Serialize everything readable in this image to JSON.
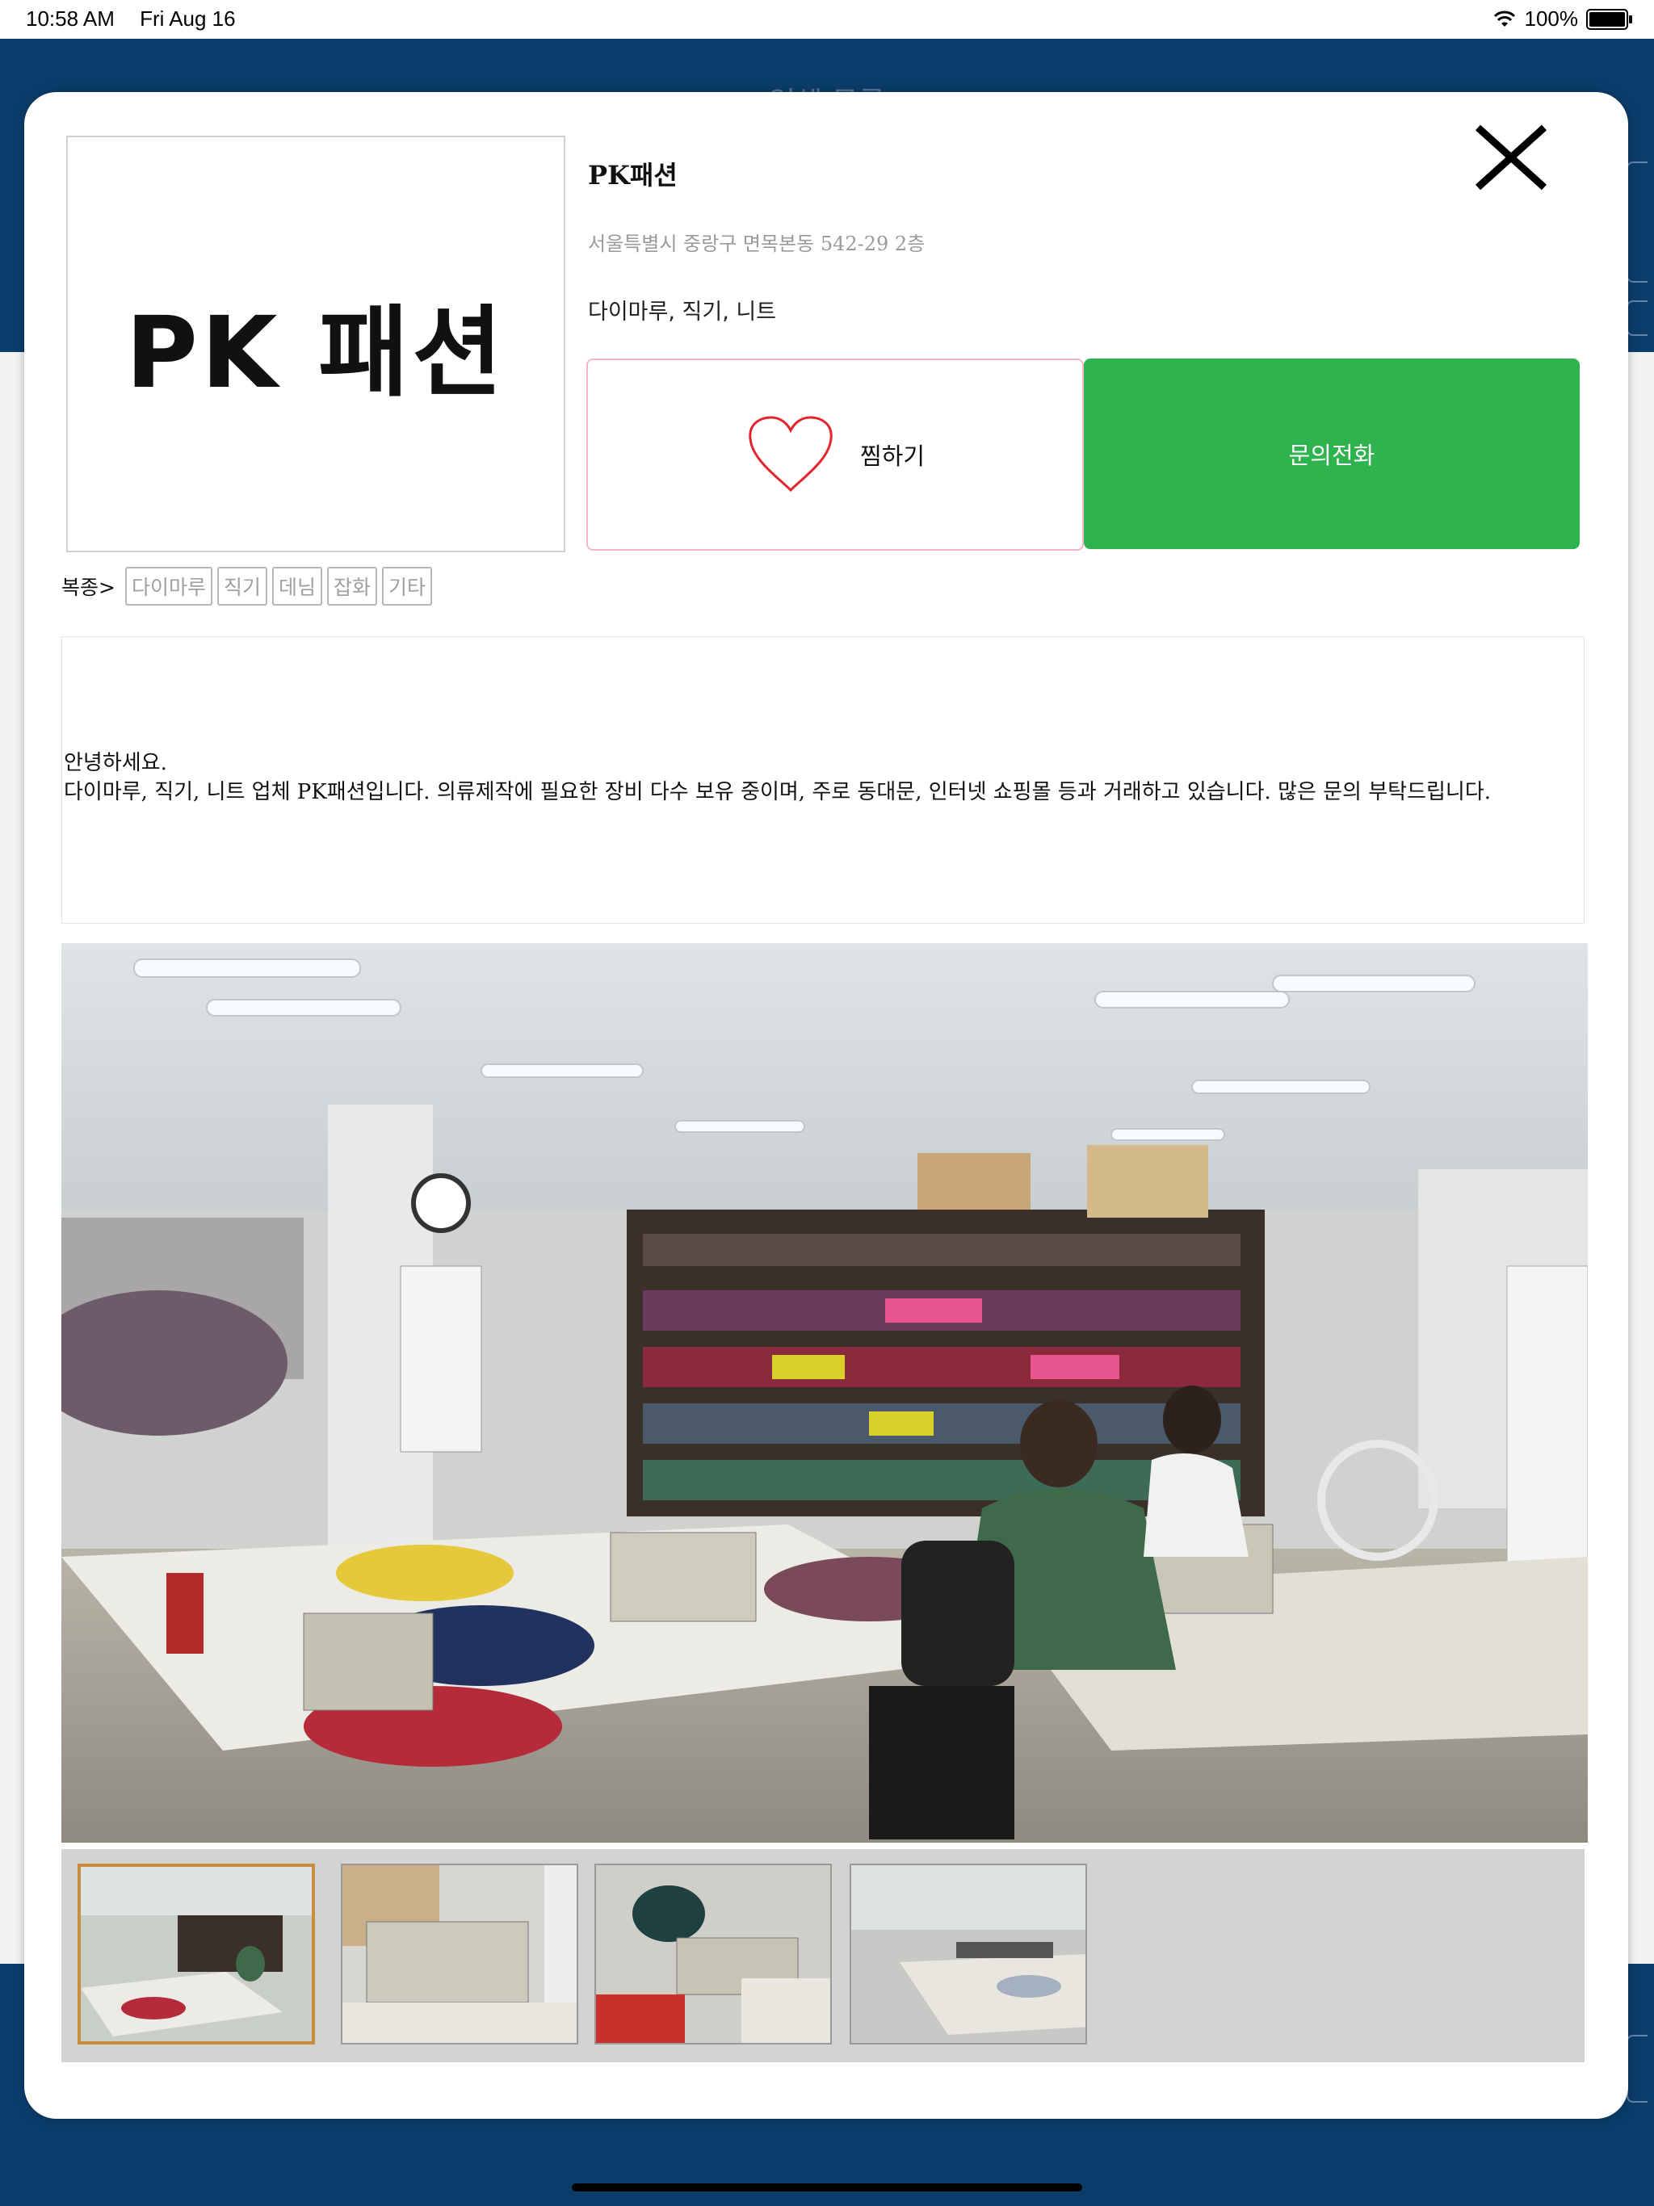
{
  "status_bar": {
    "time": "10:58 AM",
    "date": "Fri Aug 16",
    "battery": "100%",
    "battery_level": 1.0
  },
  "background": {
    "header_title": "업체 목록"
  },
  "shop": {
    "logo_text": "PK 패션",
    "name": "PK패션",
    "address": "서울특별시 중랑구 면목본동 542-29 2층",
    "categories": "다이마루, 직기, 니트",
    "wish_label": "찜하기",
    "call_label": "문의전화",
    "fabric_label": "복종>",
    "fabric_tags": [
      "다이마루",
      "직기",
      "데님",
      "잡화",
      "기타"
    ],
    "description_line1": "안녕하세요.",
    "description_line2": "다이마루, 직기, 니트 업체 PK패션입니다. 의류제작에 필요한 장비 다수 보유 중이며, 주로 동대문, 인터넷 쇼핑몰 등과 거래하고 있습니다. 많은 문의 부탁드립니다."
  },
  "icons": {
    "close": "close-icon",
    "heart": "heart-icon",
    "wifi": "wifi-icon",
    "battery": "battery-icon"
  },
  "colors": {
    "accent_green": "#2eb34f",
    "nav_blue": "#0b3d6b",
    "wish_border": "#f3b6c8",
    "heart_red": "#e3262d",
    "active_thumb_border": "#c98d3e"
  },
  "gallery": {
    "selected_index": 0,
    "thumbnail_count": 4
  }
}
